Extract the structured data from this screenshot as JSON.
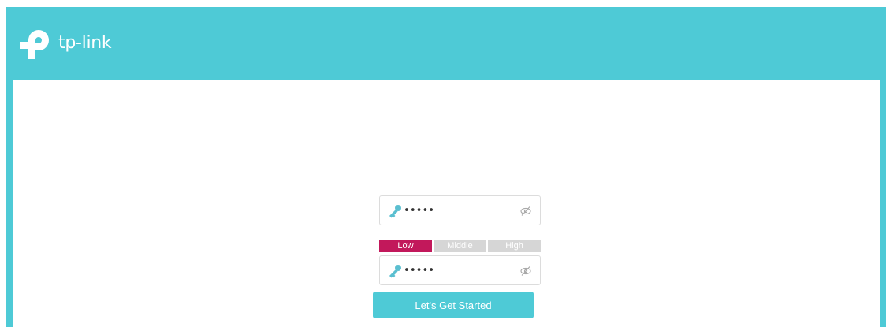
{
  "brand": {
    "name": "tp-link",
    "color": "#4ecad6"
  },
  "password": {
    "value": "•••••",
    "key_icon": "key-icon",
    "toggle_icon": "eye-slash-icon"
  },
  "confirm_password": {
    "value": "•••••",
    "key_icon": "key-icon",
    "toggle_icon": "eye-slash-icon"
  },
  "strength": {
    "levels": [
      "Low",
      "Middle",
      "High"
    ],
    "current": "Low",
    "active_color": "#c2185b",
    "inactive_color": "#d6d6d6"
  },
  "actions": {
    "start_label": "Let's Get Started"
  }
}
